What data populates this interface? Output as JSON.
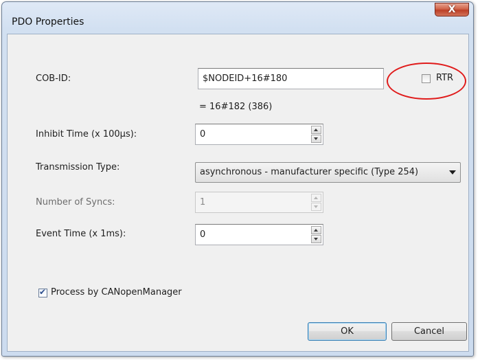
{
  "window": {
    "title": "PDO Properties",
    "close_label": "X"
  },
  "cob_id": {
    "label": "COB-ID:",
    "value": "$NODEID+16#180",
    "result": "= 16#182 (386)",
    "rtr_label": "RTR",
    "rtr_checked": false
  },
  "inhibit_time": {
    "label": "Inhibit Time (x 100µs):",
    "value": "0"
  },
  "transmission_type": {
    "label": "Transmission Type:",
    "selected": "asynchronous - manufacturer specific (Type 254)"
  },
  "number_of_syncs": {
    "label": "Number of Syncs:",
    "value": "1",
    "enabled": false
  },
  "event_time": {
    "label": "Event Time (x 1ms):",
    "value": "0"
  },
  "process_by_manager": {
    "label": "Process by CANopenManager",
    "checked": true
  },
  "buttons": {
    "ok": "OK",
    "cancel": "Cancel"
  },
  "colors": {
    "annotation_circle": "#e01b1b",
    "close_button": "#c9543b"
  }
}
